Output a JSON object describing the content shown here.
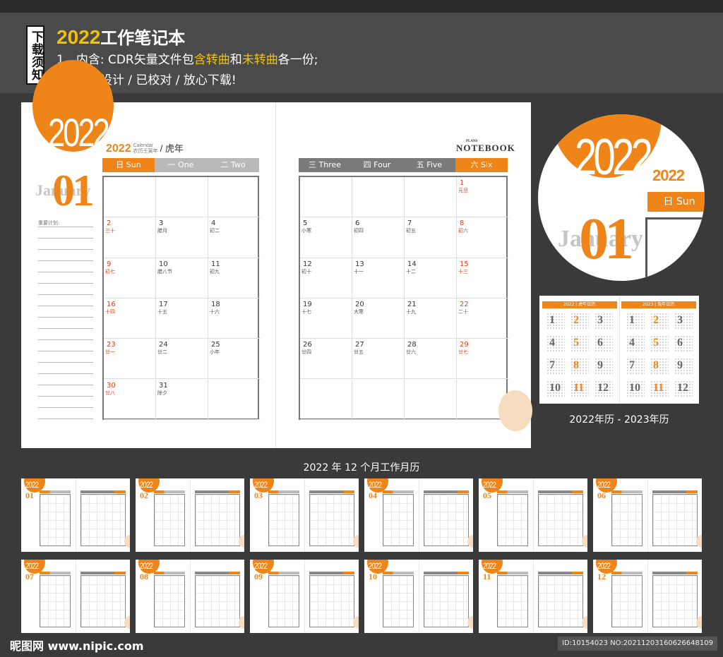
{
  "header": {
    "notice": "下载须知",
    "title_year": "2022",
    "title_rest": "工作笔记本",
    "line1": {
      "a": "1、内含: CDR矢量文件包",
      "b": "含转曲",
      "c": "和",
      "d": "未转曲",
      "e": "各一份;"
    },
    "line2": "2、精心设计 / 已校对 / 放心下载!"
  },
  "spread": {
    "big_year": "2022",
    "sub_year": "2022",
    "calendar_word": "Calendar",
    "lunar_small": "农历壬寅年",
    "tiger_year": "/ 虎年",
    "month_number": "01",
    "month_name": "January",
    "plan_label": "重要计划:",
    "notebook_logo": "NOTEBOOK",
    "plans_word": "PLANS",
    "left_days": [
      "日 Sun",
      "一 One",
      "二 Two"
    ],
    "right_days": [
      "三 Three",
      "四 Four",
      "五 Five",
      "六 Six"
    ],
    "left_rows": [
      [
        null,
        null,
        null
      ],
      [
        {
          "d": "2",
          "l": "三十",
          "r": true
        },
        {
          "d": "3",
          "l": "腊月"
        },
        {
          "d": "4",
          "l": "初二"
        }
      ],
      [
        {
          "d": "9",
          "l": "初七",
          "r": true
        },
        {
          "d": "10",
          "l": "腊八节"
        },
        {
          "d": "11",
          "l": "初九"
        }
      ],
      [
        {
          "d": "16",
          "l": "十四",
          "r": true
        },
        {
          "d": "17",
          "l": "十五"
        },
        {
          "d": "18",
          "l": "十六"
        }
      ],
      [
        {
          "d": "23",
          "l": "廿一",
          "r": true
        },
        {
          "d": "24",
          "l": "廿二"
        },
        {
          "d": "25",
          "l": "小年"
        }
      ],
      [
        {
          "d": "30",
          "l": "廿八",
          "r": true
        },
        {
          "d": "31",
          "l": "除夕"
        },
        null
      ]
    ],
    "right_rows": [
      [
        null,
        null,
        null,
        {
          "d": "1",
          "l": "元旦",
          "r": true
        }
      ],
      [
        {
          "d": "5",
          "l": "小寒"
        },
        {
          "d": "6",
          "l": "初四"
        },
        {
          "d": "7",
          "l": "初五"
        },
        {
          "d": "8",
          "l": "初六",
          "r": true
        }
      ],
      [
        {
          "d": "12",
          "l": "初十"
        },
        {
          "d": "13",
          "l": "十一"
        },
        {
          "d": "14",
          "l": "十二"
        },
        {
          "d": "15",
          "l": "十三",
          "r": true
        }
      ],
      [
        {
          "d": "19",
          "l": "十七"
        },
        {
          "d": "20",
          "l": "大寒"
        },
        {
          "d": "21",
          "l": "十九"
        },
        {
          "d": "22",
          "l": "二十",
          "r": true
        }
      ],
      [
        {
          "d": "26",
          "l": "廿四"
        },
        {
          "d": "27",
          "l": "廿五"
        },
        {
          "d": "28",
          "l": "廿六"
        },
        {
          "d": "29",
          "l": "廿七",
          "r": true
        }
      ],
      [
        null,
        null,
        null,
        null
      ]
    ]
  },
  "zoom": {
    "year": "2022",
    "sub_year": "2022",
    "sun": "日 Sun",
    "month_number": "01",
    "month_name": "January"
  },
  "mini_year": {
    "left_band": "2022 | 虎年日历",
    "right_band": "2023 | 兔年日历",
    "months": [
      "1",
      "2",
      "3",
      "4",
      "5",
      "6",
      "7",
      "8",
      "9",
      "10",
      "11",
      "12"
    ],
    "caption": "2022年历 - 2023年历"
  },
  "thumbnails": {
    "caption": "2022 年 12 个月工作月历",
    "year": "2022",
    "months": [
      "01",
      "02",
      "03",
      "04",
      "05",
      "06",
      "07",
      "08",
      "09",
      "10",
      "11",
      "12"
    ]
  },
  "footer": {
    "logo": "昵图网 www.nipic.com",
    "id_text": "ID:10154023 NO:20211203160626648109"
  },
  "colors": {
    "accent": "#ef8418",
    "gray_header": "#b9b9b9",
    "dark_header": "#7a7a7a"
  }
}
